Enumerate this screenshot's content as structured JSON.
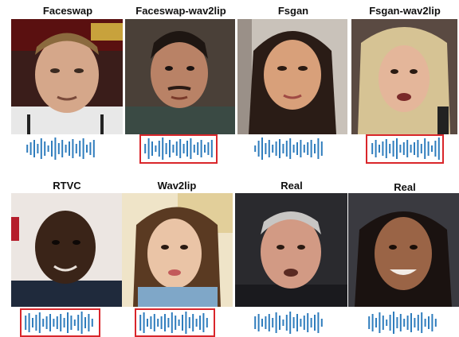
{
  "colors": {
    "waveform": "#2f7dbd",
    "highlight_box": "#d9262b",
    "label_text": "#111111"
  },
  "rows": [
    {
      "items": [
        {
          "label": "Faceswap",
          "highlighted": false,
          "face": "man-blonde-press-room"
        },
        {
          "label": "Faceswap-wav2lip",
          "highlighted": true,
          "face": "man-dark-hair-mustache"
        },
        {
          "label": "Fsgan",
          "highlighted": false,
          "face": "woman-dark-hair"
        },
        {
          "label": "Fsgan-wav2lip",
          "highlighted": true,
          "face": "woman-blonde-hair"
        }
      ]
    },
    {
      "items": [
        {
          "label": "RTVC",
          "highlighted": true,
          "face": "man-dark-skin"
        },
        {
          "label": "Wav2lip",
          "highlighted": true,
          "face": "woman-brown-hair"
        },
        {
          "label": "Real",
          "highlighted": false,
          "face": "older-man-grey-hair"
        },
        {
          "label": "Real",
          "highlighted": false,
          "face": "woman-smiling"
        }
      ]
    }
  ]
}
